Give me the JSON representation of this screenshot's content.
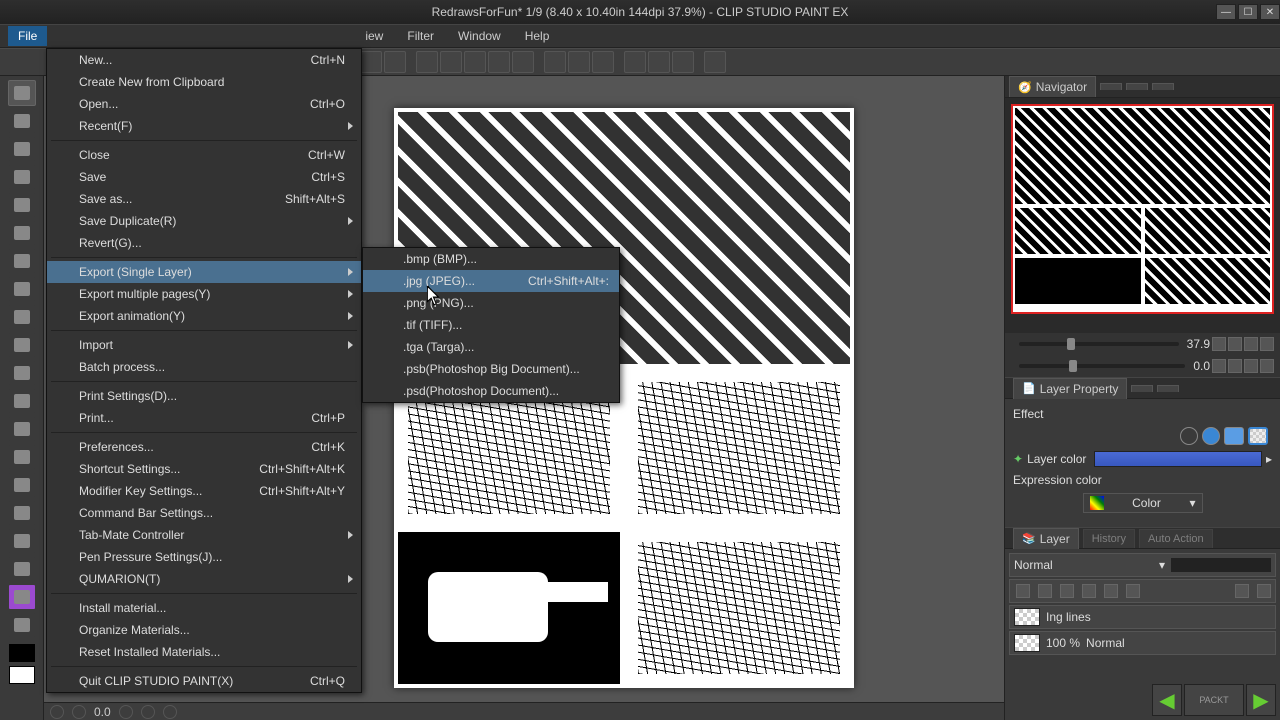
{
  "window": {
    "title": "RedrawsForFun* 1/9 (8.40 x 10.40in 144dpi 37.9%)  -  CLIP STUDIO PAINT EX"
  },
  "menubar": {
    "file": "File",
    "view": "iew",
    "filter": "Filter",
    "window": "Window",
    "help": "Help"
  },
  "file_menu": [
    {
      "label": "New...",
      "shortcut": "Ctrl+N"
    },
    {
      "label": "Create New from Clipboard",
      "shortcut": ""
    },
    {
      "label": "Open...",
      "shortcut": "Ctrl+O"
    },
    {
      "label": "Recent(F)",
      "shortcut": "",
      "sub": true
    },
    {
      "sep": true
    },
    {
      "label": "Close",
      "shortcut": "Ctrl+W"
    },
    {
      "label": "Save",
      "shortcut": "Ctrl+S"
    },
    {
      "label": "Save as...",
      "shortcut": "Shift+Alt+S"
    },
    {
      "label": "Save Duplicate(R)",
      "shortcut": "",
      "sub": true
    },
    {
      "label": "Revert(G)...",
      "shortcut": ""
    },
    {
      "sep": true
    },
    {
      "label": "Export (Single Layer)",
      "shortcut": "",
      "sub": true,
      "hl": true
    },
    {
      "label": "Export multiple pages(Y)",
      "shortcut": "",
      "sub": true
    },
    {
      "label": "Export animation(Y)",
      "shortcut": "",
      "sub": true
    },
    {
      "sep": true
    },
    {
      "label": "Import",
      "shortcut": "",
      "sub": true
    },
    {
      "label": "Batch process...",
      "shortcut": ""
    },
    {
      "sep": true
    },
    {
      "label": "Print Settings(D)...",
      "shortcut": ""
    },
    {
      "label": "Print...",
      "shortcut": "Ctrl+P"
    },
    {
      "sep": true
    },
    {
      "label": "Preferences...",
      "shortcut": "Ctrl+K"
    },
    {
      "label": "Shortcut Settings...",
      "shortcut": "Ctrl+Shift+Alt+K"
    },
    {
      "label": "Modifier Key Settings...",
      "shortcut": "Ctrl+Shift+Alt+Y"
    },
    {
      "label": "Command Bar Settings...",
      "shortcut": ""
    },
    {
      "label": "Tab-Mate Controller",
      "shortcut": "",
      "sub": true
    },
    {
      "label": "Pen Pressure Settings(J)...",
      "shortcut": ""
    },
    {
      "label": "QUMARION(T)",
      "shortcut": "",
      "sub": true
    },
    {
      "sep": true
    },
    {
      "label": "Install material...",
      "shortcut": ""
    },
    {
      "label": "Organize Materials...",
      "shortcut": ""
    },
    {
      "label": "Reset Installed Materials...",
      "shortcut": ""
    },
    {
      "sep": true
    },
    {
      "label": "Quit CLIP STUDIO PAINT(X)",
      "shortcut": "Ctrl+Q"
    }
  ],
  "export_sub": [
    {
      "label": ".bmp (BMP)...",
      "shortcut": ""
    },
    {
      "label": ".jpg (JPEG)...",
      "shortcut": "Ctrl+Shift+Alt+:",
      "hl": true
    },
    {
      "label": ".png (PNG)...",
      "shortcut": ""
    },
    {
      "label": ".tif (TIFF)...",
      "shortcut": ""
    },
    {
      "label": ".tga (Targa)...",
      "shortcut": ""
    },
    {
      "label": ".psb(Photoshop Big Document)...",
      "shortcut": ""
    },
    {
      "label": ".psd(Photoshop Document)...",
      "shortcut": ""
    }
  ],
  "navigator": {
    "tab": "Navigator",
    "zoom": "37.9",
    "rotation": "0.0"
  },
  "layer_property": {
    "tab": "Layer Property",
    "effect": "Effect",
    "layer_color": "Layer color",
    "expression": "Expression color",
    "mode": "Color"
  },
  "layers": {
    "tab_layer": "Layer",
    "tab_history": "History",
    "tab_action": "Auto Action",
    "blend": "Normal",
    "opacity": "100 %",
    "mode2": "Normal",
    "lines_label": "Ing lines"
  },
  "status": {
    "frame": "0.0"
  }
}
